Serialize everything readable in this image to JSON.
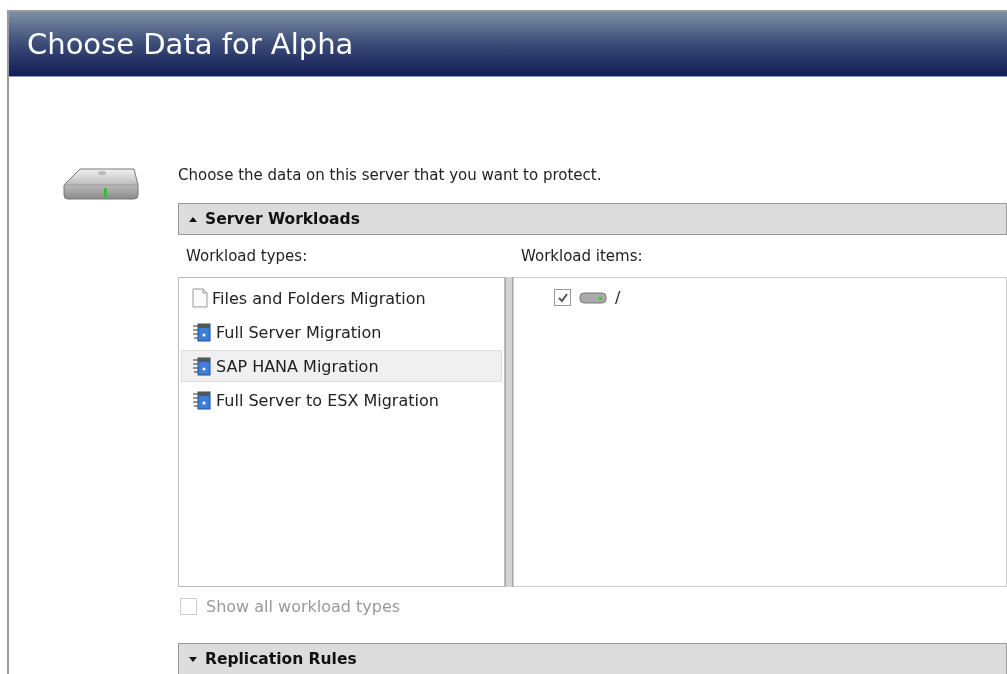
{
  "window": {
    "title": "Choose Data for Alpha"
  },
  "intro": "Choose the data on this server that you want to protect.",
  "sections": [
    {
      "title": "Server Workloads",
      "expanded": true,
      "types_label": "Workload types:",
      "items_label": "Workload items:",
      "workload_types": [
        {
          "label": "Files and Folders Migration",
          "kind": "file",
          "selected": false
        },
        {
          "label": "Full Server Migration",
          "kind": "server",
          "selected": false
        },
        {
          "label": "SAP HANA Migration",
          "kind": "server",
          "selected": true
        },
        {
          "label": "Full Server to ESX Migration",
          "kind": "server",
          "selected": false
        }
      ],
      "workload_items": [
        {
          "label": "/",
          "checked": true
        }
      ],
      "show_all": {
        "label": "Show all workload types",
        "checked": false,
        "disabled": true
      }
    },
    {
      "title": "Replication Rules",
      "expanded": false
    }
  ]
}
